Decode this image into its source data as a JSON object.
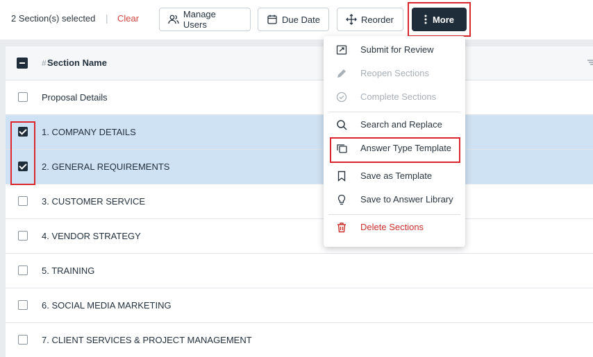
{
  "toolbar": {
    "selection_count": "2 Section(s) selected",
    "separator": "|",
    "clear_label": "Clear",
    "manage_users_label": "Manage Users",
    "due_date_label": "Due Date",
    "reorder_label": "Reorder",
    "more_label": "More"
  },
  "table": {
    "hash": "#",
    "header_name": "Section Name",
    "rows": [
      {
        "name": "Proposal Details",
        "checked": false
      },
      {
        "name": "1. COMPANY DETAILS",
        "checked": true
      },
      {
        "name": "2. GENERAL REQUIREMENTS",
        "checked": true
      },
      {
        "name": "3. CUSTOMER SERVICE",
        "checked": false
      },
      {
        "name": "4. VENDOR STRATEGY",
        "checked": false
      },
      {
        "name": "5. TRAINING",
        "checked": false
      },
      {
        "name": "6. SOCIAL MEDIA MARKETING",
        "checked": false
      },
      {
        "name": "7. CLIENT SERVICES & PROJECT MANAGEMENT",
        "checked": false
      }
    ]
  },
  "menu": {
    "items": [
      {
        "label": "Submit for Review",
        "icon": "submit-review-icon",
        "state": "enabled"
      },
      {
        "label": "Reopen Sections",
        "icon": "pencil-icon",
        "state": "disabled"
      },
      {
        "label": "Complete Sections",
        "icon": "check-circle-icon",
        "state": "disabled"
      },
      {
        "label": "Search and Replace",
        "icon": "search-icon",
        "state": "enabled"
      },
      {
        "label": "Answer Type Template",
        "icon": "copy-icon",
        "state": "enabled"
      },
      {
        "label": "Save as Template",
        "icon": "bookmark-icon",
        "state": "enabled"
      },
      {
        "label": "Save to Answer Library",
        "icon": "lightbulb-icon",
        "state": "enabled"
      },
      {
        "label": "Delete Sections",
        "icon": "trash-icon",
        "state": "danger"
      }
    ]
  },
  "colors": {
    "primary_dark": "#1f2d3a",
    "highlight_red": "#d9252b",
    "selected_row": "#cfe2f3",
    "danger": "#c9302c"
  }
}
